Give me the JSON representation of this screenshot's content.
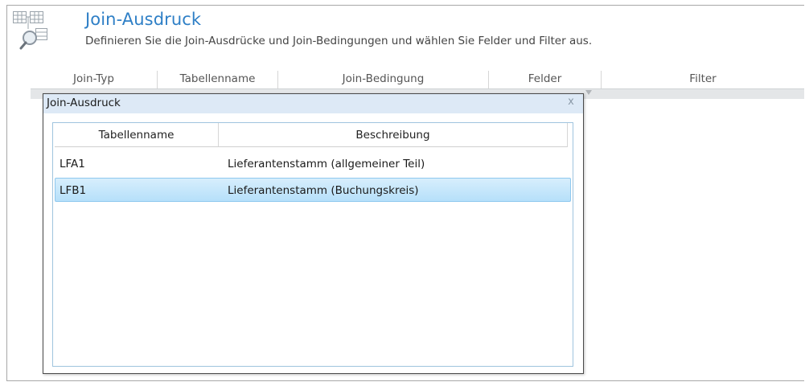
{
  "header": {
    "title": "Join-Ausdruck",
    "subtitle": "Definieren Sie die Join-Ausdrücke und Join-Bedingungen und wählen Sie Felder und Filter aus.",
    "icon": "table-search-icon"
  },
  "grid": {
    "columns": [
      "Join-Typ",
      "Tabellenname",
      "Join-Bedingung",
      "Felder",
      "Filter"
    ]
  },
  "dialog": {
    "title": "Join-Ausdruck",
    "close_label": "x",
    "list": {
      "columns": [
        "Tabellenname",
        "Beschreibung"
      ],
      "rows": [
        {
          "table": "LFA1",
          "description": "Lieferantenstamm (allgemeiner Teil)",
          "selected": false
        },
        {
          "table": "LFB1",
          "description": "Lieferantenstamm (Buchungskreis)",
          "selected": true
        }
      ]
    }
  },
  "colors": {
    "title": "#2e7fc6",
    "selection": "#b6e0fa",
    "dialog_header": "#dde9f6"
  }
}
